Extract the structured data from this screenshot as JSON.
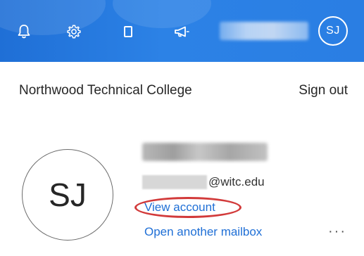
{
  "header": {
    "avatar_initials": "SJ",
    "icons": [
      "bell-icon",
      "gear-icon",
      "mobile-icon",
      "megaphone-icon"
    ]
  },
  "account": {
    "organization": "Northwood Technical College",
    "sign_out_label": "Sign out",
    "avatar_initials": "SJ",
    "email_domain": "@witc.edu",
    "view_account_label": "View account",
    "open_mailbox_label": "Open another mailbox",
    "more_label": "···"
  },
  "colors": {
    "topbar": "#2a7ee3",
    "link": "#1f6fd6",
    "highlight": "#d23a3a"
  }
}
